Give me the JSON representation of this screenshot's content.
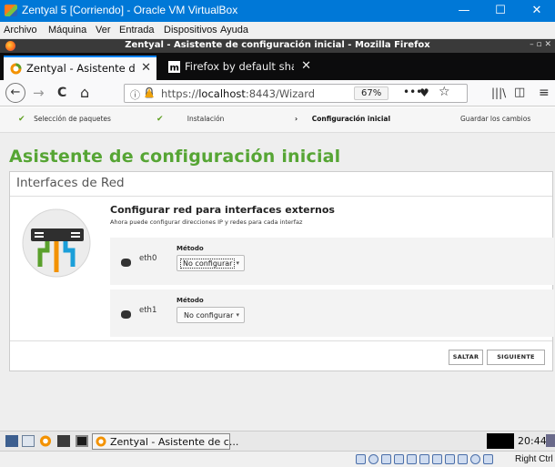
{
  "vbox": {
    "title": "Zentyal 5 [Corriendo] - Oracle VM VirtualBox",
    "controls": {
      "minimize": "—",
      "maximize": "☐",
      "close": "✕"
    },
    "menu": [
      "Archivo",
      "Máquina",
      "Ver",
      "Entrada",
      "Dispositivos",
      "Ayuda"
    ],
    "host_key": "Right Ctrl"
  },
  "firefox": {
    "window_title": "Zentyal - Asistente de configuración inicial - Mozilla Firefox",
    "window_controls": "– ▫ ✕",
    "tabs": [
      {
        "label": "Zentyal - Asistente de co",
        "icon": "zentyal-icon",
        "active": true
      },
      {
        "label": "Firefox by default shares",
        "icon": "mozilla-m-icon",
        "active": false
      }
    ],
    "tab_close": "✕",
    "new_tab": "+",
    "nav": {
      "back": "←",
      "forward": "→",
      "reload": "C",
      "home": "⌂"
    },
    "url": {
      "info_icon": "ⓘ",
      "prefix": "https://",
      "host": "localhost",
      "rest": ":8443/Wizard"
    },
    "zoom": "67%",
    "page_actions": "•••",
    "pocket": "♥",
    "bookmark_star": "☆",
    "library": "|||\\",
    "sidebar": "◫",
    "menu_button": "≡"
  },
  "wizard": {
    "steps": [
      {
        "label": "Selección de paquetes",
        "marker": "✔",
        "state": "done"
      },
      {
        "label": "Instalación",
        "marker": "✔",
        "state": "done"
      },
      {
        "label": "Configuración inicial",
        "marker": "›",
        "state": "current"
      },
      {
        "label": "Guardar los cambios",
        "marker": "",
        "state": "pending"
      }
    ],
    "title": "Asistente de configuración inicial",
    "card_header": "Interfaces de Red",
    "section_title": "Configurar red para interfaces externos",
    "section_desc": "Ahora puede configurar direcciones IP y redes para cada interfaz",
    "method_label": "Método",
    "interfaces": [
      {
        "name": "eth0",
        "method": "No configurar",
        "focused": true
      },
      {
        "name": "eth1",
        "method": "No configurar",
        "focused": false
      }
    ],
    "select_arrow": "▾",
    "buttons": {
      "skip": "SALTAR",
      "next": "SIGUIENTE"
    },
    "colors": {
      "accent_green": "#56a534",
      "check_green": "#5fa022"
    }
  },
  "guest_taskbar": {
    "task_label": "Zentyal - Asistente de c...",
    "clock": "20:44"
  }
}
